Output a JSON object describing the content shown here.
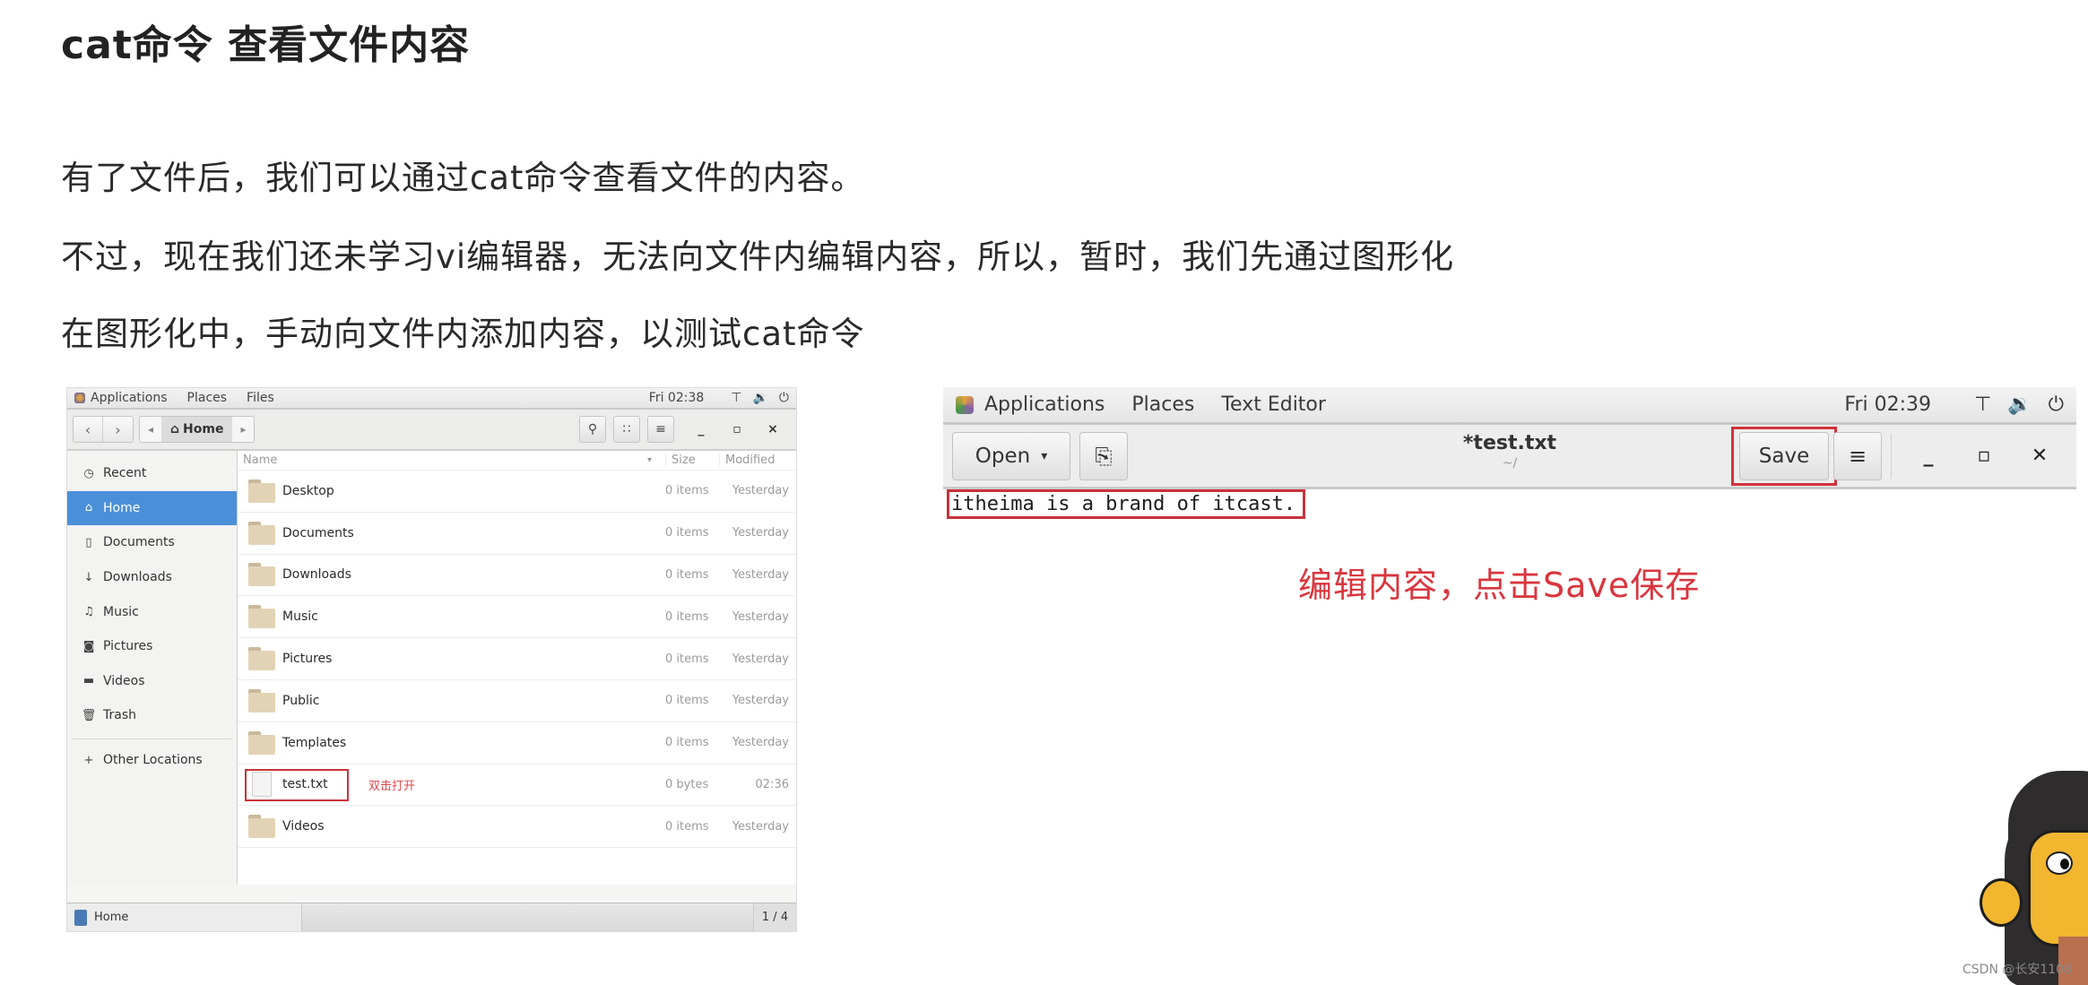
{
  "heading": "cat命令 查看文件内容",
  "paragraphs": [
    "有了文件后，我们可以通过cat命令查看文件的内容。",
    "不过，现在我们还未学习vi编辑器，无法向文件内编辑内容，所以，暂时，我们先通过图形化",
    "在图形化中，手动向文件内添加内容，以测试cat命令"
  ],
  "file_manager": {
    "topbar": {
      "menus": [
        "Applications",
        "Places",
        "Files"
      ],
      "clock": "Fri 02:38"
    },
    "toolbar": {
      "back": "‹",
      "forward": "›",
      "path_prev": "◂",
      "path_next": "▸",
      "path_home_icon": "⌂",
      "path_label": "Home",
      "search": "🔍",
      "grid": "∷",
      "menu": "≡",
      "minimize": "_",
      "maximize": "▫",
      "close": "×"
    },
    "sidebar": [
      {
        "icon": "◷",
        "label": "Recent"
      },
      {
        "icon": "⌂",
        "label": "Home",
        "active": true
      },
      {
        "icon": "▯",
        "label": "Documents"
      },
      {
        "icon": "↓",
        "label": "Downloads"
      },
      {
        "icon": "♫",
        "label": "Music"
      },
      {
        "icon": "◙",
        "label": "Pictures"
      },
      {
        "icon": "▬",
        "label": "Videos"
      },
      {
        "icon": "🗑",
        "label": "Trash"
      },
      {
        "icon": "+",
        "label": "Other Locations"
      }
    ],
    "columns": {
      "name": "Name",
      "size": "Size",
      "modified": "Modified"
    },
    "rows": [
      {
        "name": "Desktop",
        "size": "0 items",
        "modified": "Yesterday",
        "type": "folder"
      },
      {
        "name": "Documents",
        "size": "0 items",
        "modified": "Yesterday",
        "type": "folder"
      },
      {
        "name": "Downloads",
        "size": "0 items",
        "modified": "Yesterday",
        "type": "folder"
      },
      {
        "name": "Music",
        "size": "0 items",
        "modified": "Yesterday",
        "type": "folder"
      },
      {
        "name": "Pictures",
        "size": "0 items",
        "modified": "Yesterday",
        "type": "folder"
      },
      {
        "name": "Public",
        "size": "0 items",
        "modified": "Yesterday",
        "type": "folder"
      },
      {
        "name": "Templates",
        "size": "0 items",
        "modified": "Yesterday",
        "type": "folder"
      },
      {
        "name": "test.txt",
        "size": "0 bytes",
        "modified": "02:36",
        "type": "file",
        "note": "双击打开"
      },
      {
        "name": "Videos",
        "size": "0 items",
        "modified": "Yesterday",
        "type": "folder"
      }
    ],
    "statusbar": {
      "task_label": "Home",
      "pager": "1 / 4"
    }
  },
  "text_editor": {
    "topbar": {
      "menus": [
        "Applications",
        "Places",
        "Text Editor"
      ],
      "clock": "Fri 02:39"
    },
    "header": {
      "open_label": "Open",
      "open_caret": "▾",
      "new_icon": "⎘",
      "title": "*test.txt",
      "subtitle": "~/",
      "save_label": "Save",
      "menu_icon": "≡",
      "minimize": "_",
      "maximize": "▫",
      "close": "✕"
    },
    "content": "itheima is a brand of itcast."
  },
  "annotation": "编辑内容，点击Save保存",
  "tray_icons": {
    "network": "⊤",
    "volume": "🔉",
    "power": "⏻"
  },
  "watermark": "CSDN @长安1108",
  "colors": {
    "accent_blue": "#4a90d9",
    "highlight_red": "#c8323a",
    "note_red": "#d9363e"
  }
}
